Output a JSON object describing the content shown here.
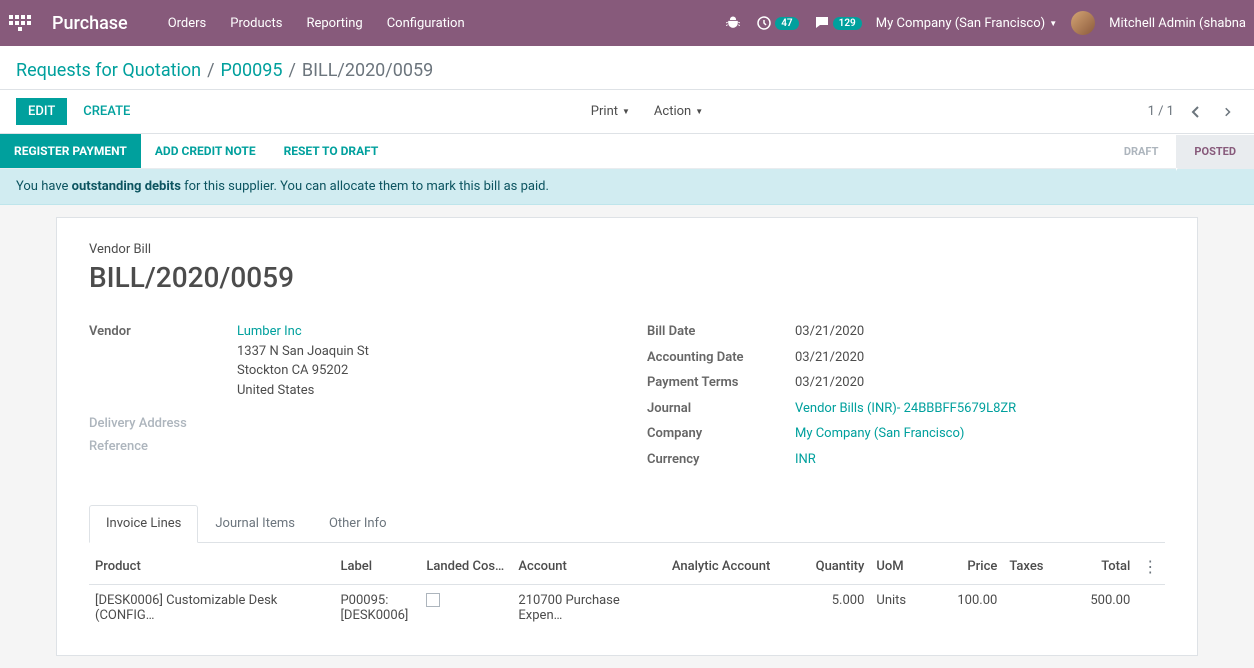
{
  "topbar": {
    "brand": "Purchase",
    "menu": [
      "Orders",
      "Products",
      "Reporting",
      "Configuration"
    ],
    "clock_badge": "47",
    "chat_badge": "129",
    "company": "My Company (San Francisco)",
    "user": "Mitchell Admin (shabna"
  },
  "breadcrumb": {
    "items": [
      {
        "label": "Requests for Quotation",
        "link": true
      },
      {
        "label": "P00095",
        "link": true
      },
      {
        "label": "BILL/2020/0059",
        "link": false
      }
    ]
  },
  "controls": {
    "edit": "EDIT",
    "create": "CREATE",
    "print": "Print",
    "action": "Action",
    "pager": "1 / 1"
  },
  "statusbar": {
    "register_payment": "REGISTER PAYMENT",
    "add_credit_note": "ADD CREDIT NOTE",
    "reset_to_draft": "RESET TO DRAFT",
    "statuses": [
      "DRAFT",
      "POSTED"
    ],
    "active_status": "POSTED"
  },
  "alert": {
    "prefix": "You have ",
    "strong": "outstanding debits",
    "suffix": " for this supplier. You can allocate them to mark this bill as paid."
  },
  "sheet": {
    "type_label": "Vendor Bill",
    "title": "BILL/2020/0059",
    "left_fields": {
      "vendor_label": "Vendor",
      "vendor_name": "Lumber Inc",
      "vendor_addr1": "1337 N San Joaquin St",
      "vendor_addr2": "Stockton CA 95202",
      "vendor_country": "United States",
      "delivery_label": "Delivery Address",
      "reference_label": "Reference"
    },
    "right_fields": {
      "bill_date_label": "Bill Date",
      "bill_date": "03/21/2020",
      "accounting_date_label": "Accounting Date",
      "accounting_date": "03/21/2020",
      "payment_terms_label": "Payment Terms",
      "payment_terms": "03/21/2020",
      "journal_label": "Journal",
      "journal": "Vendor Bills (INR)- 24BBBFF5679L8ZR",
      "company_label": "Company",
      "company": "My Company (San Francisco)",
      "currency_label": "Currency",
      "currency": "INR"
    },
    "tabs": [
      "Invoice Lines",
      "Journal Items",
      "Other Info"
    ],
    "table": {
      "headers": [
        "Product",
        "Label",
        "Landed Cos…",
        "Account",
        "Analytic Account",
        "Quantity",
        "UoM",
        "Price",
        "Taxes",
        "Total"
      ],
      "row": {
        "product": "[DESK0006] Customizable Desk (CONFIG…",
        "label": "P00095: [DESK0006]",
        "account": "210700 Purchase Expen…",
        "quantity": "5.000",
        "uom": "Units",
        "price": "100.00",
        "total": "500.00"
      }
    }
  }
}
